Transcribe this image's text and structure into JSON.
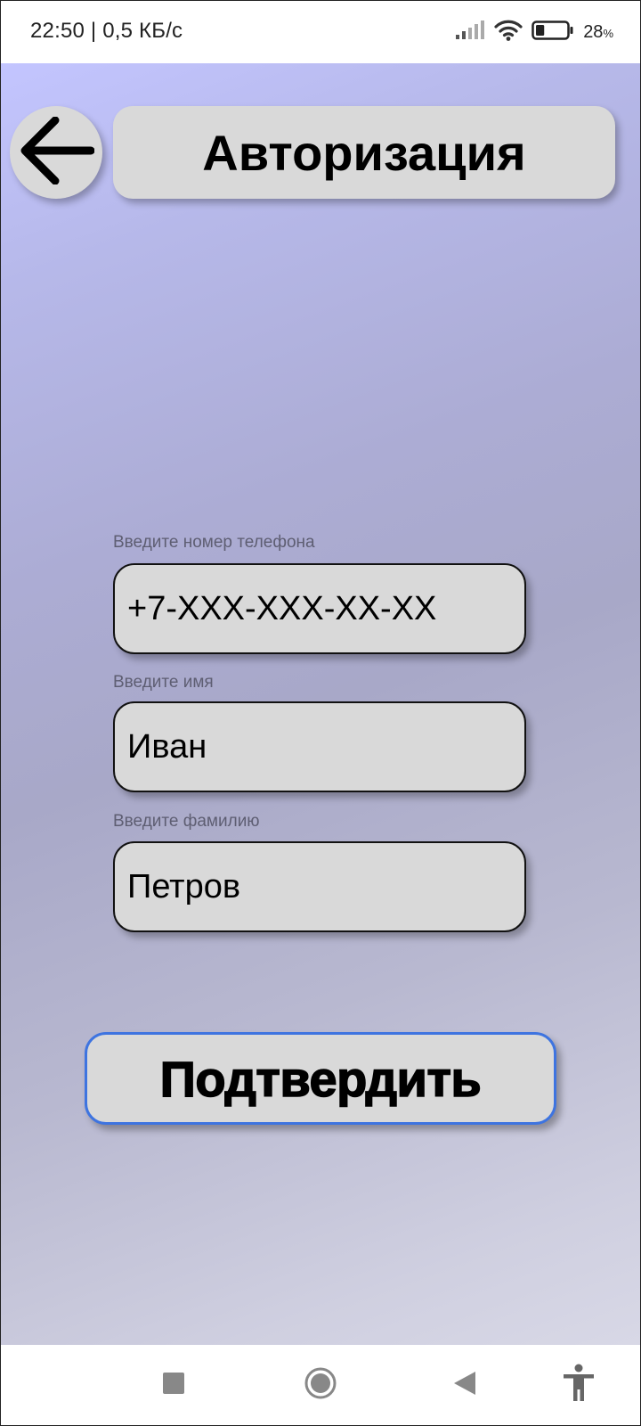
{
  "status_bar": {
    "time_speed": "22:50 | 0,5 КБ/с",
    "battery_percent": "28",
    "battery_unit": "%",
    "battery_level": 0.28,
    "icons": [
      "signal-icon",
      "wifi-icon",
      "battery-icon"
    ]
  },
  "header": {
    "title": "Авторизация",
    "back_icon": "arrow-left-icon"
  },
  "form": {
    "phone": {
      "label": "Введите номер телефона",
      "placeholder": "+7-XXX-XXX-XX-XX",
      "value": ""
    },
    "first_name": {
      "label": "Введите имя",
      "placeholder": "Иван",
      "value": ""
    },
    "last_name": {
      "label": "Введите фамилию",
      "placeholder": "Петров",
      "value": ""
    },
    "confirm_label": "Подтвердить"
  },
  "navigation": {
    "items": [
      "recents-square-icon",
      "home-circle-icon",
      "back-triangle-icon",
      "accessibility-icon"
    ]
  },
  "colors": {
    "gradient_top": "#c3c5ff",
    "gradient_bottom": "#d8d8e6",
    "control_fill": "#d9d9d9",
    "button_border": "#3e74e0"
  }
}
